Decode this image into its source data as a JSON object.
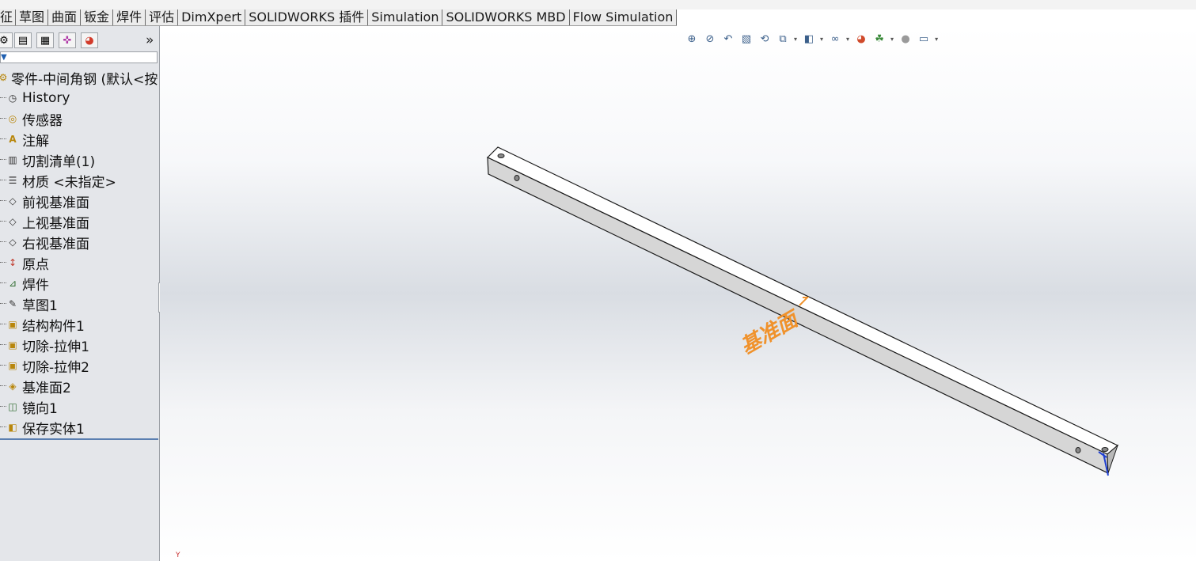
{
  "tabs": [
    {
      "label": "征"
    },
    {
      "label": "草图"
    },
    {
      "label": "曲面"
    },
    {
      "label": "钣金"
    },
    {
      "label": "焊件"
    },
    {
      "label": "评估"
    },
    {
      "label": "DimXpert"
    },
    {
      "label": "SOLIDWORKS 插件"
    },
    {
      "label": "Simulation"
    },
    {
      "label": "SOLIDWORKS MBD"
    },
    {
      "label": "Flow Simulation"
    }
  ],
  "panel": {
    "toolbar_icons": [
      "featuremanager-icon",
      "propertymanager-icon",
      "configurationmanager-icon",
      "dimxpert-icon",
      "displaymanager-icon"
    ],
    "more_label": "»",
    "filter_icon": "filter-icon"
  },
  "tree": [
    {
      "label": "零件-中间角钢 (默认<按",
      "icon": "part-icon"
    },
    {
      "label": "History",
      "icon": "history-icon"
    },
    {
      "label": "传感器",
      "icon": "sensor-icon"
    },
    {
      "label": "注解",
      "icon": "annotation-icon"
    },
    {
      "label": "切割清单(1)",
      "icon": "cutlist-icon"
    },
    {
      "label": "材质 <未指定>",
      "icon": "material-icon"
    },
    {
      "label": "前视基准面",
      "icon": "plane-icon"
    },
    {
      "label": "上视基准面",
      "icon": "plane-icon"
    },
    {
      "label": "右视基准面",
      "icon": "plane-icon"
    },
    {
      "label": "原点",
      "icon": "origin-icon"
    },
    {
      "label": "焊件",
      "icon": "weldment-icon"
    },
    {
      "label": "草图1",
      "icon": "sketch-icon"
    },
    {
      "label": "结构构件1",
      "icon": "structural-member-icon"
    },
    {
      "label": "切除-拉伸1",
      "icon": "cut-extrude-icon"
    },
    {
      "label": "切除-拉伸2",
      "icon": "cut-extrude-icon"
    },
    {
      "label": "基准面2",
      "icon": "plane-icon"
    },
    {
      "label": "镜向1",
      "icon": "mirror-icon"
    },
    {
      "label": "保存实体1",
      "icon": "save-bodies-icon"
    }
  ],
  "viewport": {
    "plane_label": "基准面",
    "plane_label_color": "#f0922c",
    "hud_icons": [
      "zoom-to-fit-icon",
      "zoom-area-icon",
      "previous-view-icon",
      "section-view-icon",
      "dynamic-annotation-icon",
      "view-orientation-icon",
      "display-style-icon",
      "hide-show-icon",
      "edit-appearance-icon",
      "apply-scene-icon",
      "view-settings-icon"
    ],
    "axis_label": "Y"
  }
}
